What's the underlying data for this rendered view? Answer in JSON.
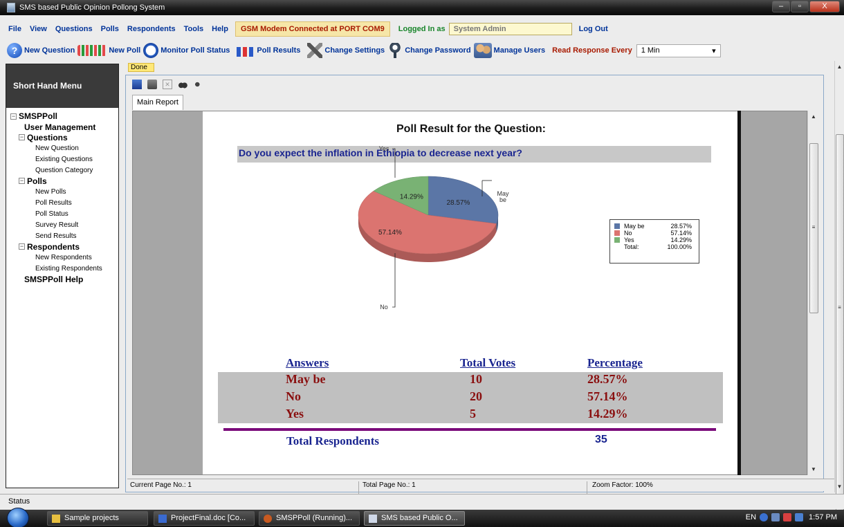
{
  "window": {
    "title": "SMS based Public Opinion Pollong System",
    "btn_min": "–",
    "btn_max": "▫",
    "btn_close": "X"
  },
  "menu": {
    "items": [
      "File",
      "View",
      "Questions",
      "Polls",
      "Respondents",
      "Tools",
      "Help"
    ],
    "gsm_status": "GSM Modem Connected at PORT COM9",
    "logged_in_label": "Logged In as",
    "user_value": "System  Admin",
    "logout": "Log Out"
  },
  "toolbar": {
    "new_question": "New Question",
    "new_poll": "New Poll",
    "monitor": "Monitor Poll Status",
    "poll_results": "Poll Results",
    "change_settings": "Change Settings",
    "change_password": "Change Password",
    "manage_users": "Manage Users",
    "read_response_label": "Read Response Every",
    "read_response_value": "1 Min",
    "question_icon_glyph": "?"
  },
  "sidemenu": {
    "header": "Short Hand Menu",
    "root": "SMSPPoll",
    "user_management": "User Management",
    "questions": "Questions",
    "question_items": [
      "New Question",
      "Existing Questions",
      "Question Category"
    ],
    "polls": "Polls",
    "poll_items": [
      "New Polls",
      "Poll Results",
      "Poll Status",
      "Survey Result",
      "Send Results"
    ],
    "respondents": "Respondents",
    "respondent_items": [
      "New Respondents",
      "Existing Respondents"
    ],
    "help": "SMSPPoll Help",
    "collapse_glyph": "−"
  },
  "report": {
    "done_label": "Done",
    "tab": "Main Report",
    "title": "Poll Result for the Question:",
    "question": "Do you expect  the inflation in Ethiopia to decrease  next year?",
    "table_headers": [
      "Answers",
      "Total Votes",
      "Percentage"
    ],
    "rows": [
      {
        "answer": "May be",
        "votes": "10",
        "pct": "28.57%"
      },
      {
        "answer": "No",
        "votes": "20",
        "pct": "57.14%"
      },
      {
        "answer": "Yes",
        "votes": "5",
        "pct": "14.29%"
      }
    ],
    "total_label": "Total Respondents",
    "total_value": "35",
    "status_current": "Current Page No.: 1",
    "status_total": "Total Page No.: 1",
    "status_zoom": "Zoom Factor: 100%",
    "close_glyph": "✕"
  },
  "chart_data": {
    "type": "pie",
    "categories": [
      "May be",
      "No",
      "Yes"
    ],
    "values": [
      28.57,
      57.14,
      14.29
    ],
    "slice_labels": [
      "28.57%",
      "57.14%",
      "14.29%"
    ],
    "callout_labels": [
      "May\nbe",
      "No",
      "Yes"
    ],
    "colors": [
      "#5b76a6",
      "#db7470",
      "#79b274"
    ],
    "legend": {
      "placement": "right",
      "entries": [
        {
          "name": "May be",
          "value": "28.57%"
        },
        {
          "name": "No",
          "value": "57.14%"
        },
        {
          "name": "Yes",
          "value": "14.29%"
        }
      ],
      "total_label": "Total:",
      "total_value": "100.00%"
    }
  },
  "statusbar": {
    "text": "Status"
  },
  "taskbar": {
    "tasks": [
      "Sample projects",
      "ProjectFinal.doc [Co...",
      "SMSPPoll (Running)...",
      "SMS based Public O..."
    ],
    "lang": "EN",
    "time": "1:57 PM"
  },
  "scroll": {
    "up": "▲",
    "down": "▼",
    "grip": "≡",
    "dropdown": "▾"
  }
}
